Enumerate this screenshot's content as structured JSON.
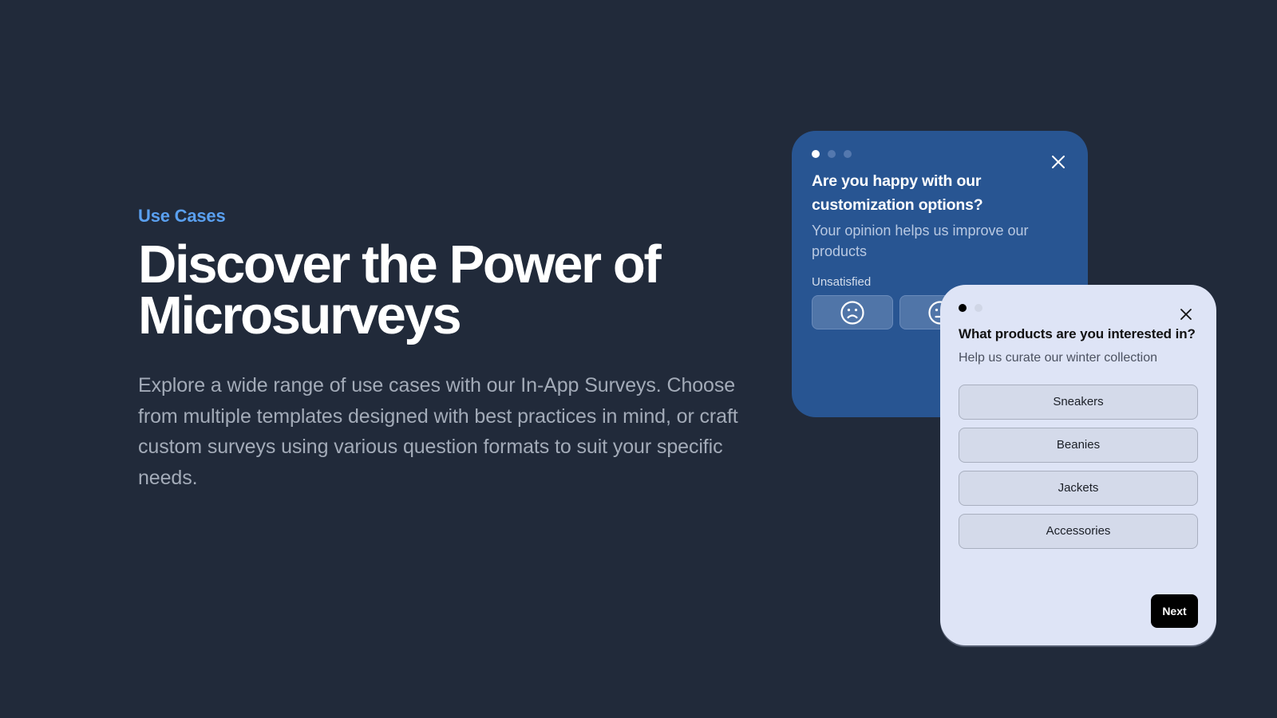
{
  "hero": {
    "eyebrow": "Use Cases",
    "headline_line1": "Discover the Power of",
    "headline_line2": "Microsurveys",
    "description": "Explore a wide range of use cases with our In-App Surveys. Choose from multiple templates designed with best practices in mind, or craft custom surveys using various question formats to suit your specific needs."
  },
  "colors": {
    "background": "#212a3a",
    "accent": "#5aa0f0",
    "card_blue": "#285592",
    "card_light": "#dee4f6",
    "next_button": "#000000"
  },
  "survey_rating": {
    "step_current": 1,
    "step_total": 3,
    "question": "Are you happy with our customization options?",
    "subtitle": "Your opinion helps us improve our products",
    "scale_label_low": "Unsatisfied",
    "options": [
      {
        "icon": "sad-face-icon"
      },
      {
        "icon": "neutral-face-icon"
      }
    ],
    "close_icon": "close-icon"
  },
  "survey_products": {
    "step_current": 1,
    "step_total": 2,
    "question": "What products are you interested in?",
    "subtitle": "Help us curate our winter collection",
    "options": [
      "Sneakers",
      "Beanies",
      "Jackets",
      "Accessories"
    ],
    "next_label": "Next",
    "close_icon": "close-icon"
  }
}
